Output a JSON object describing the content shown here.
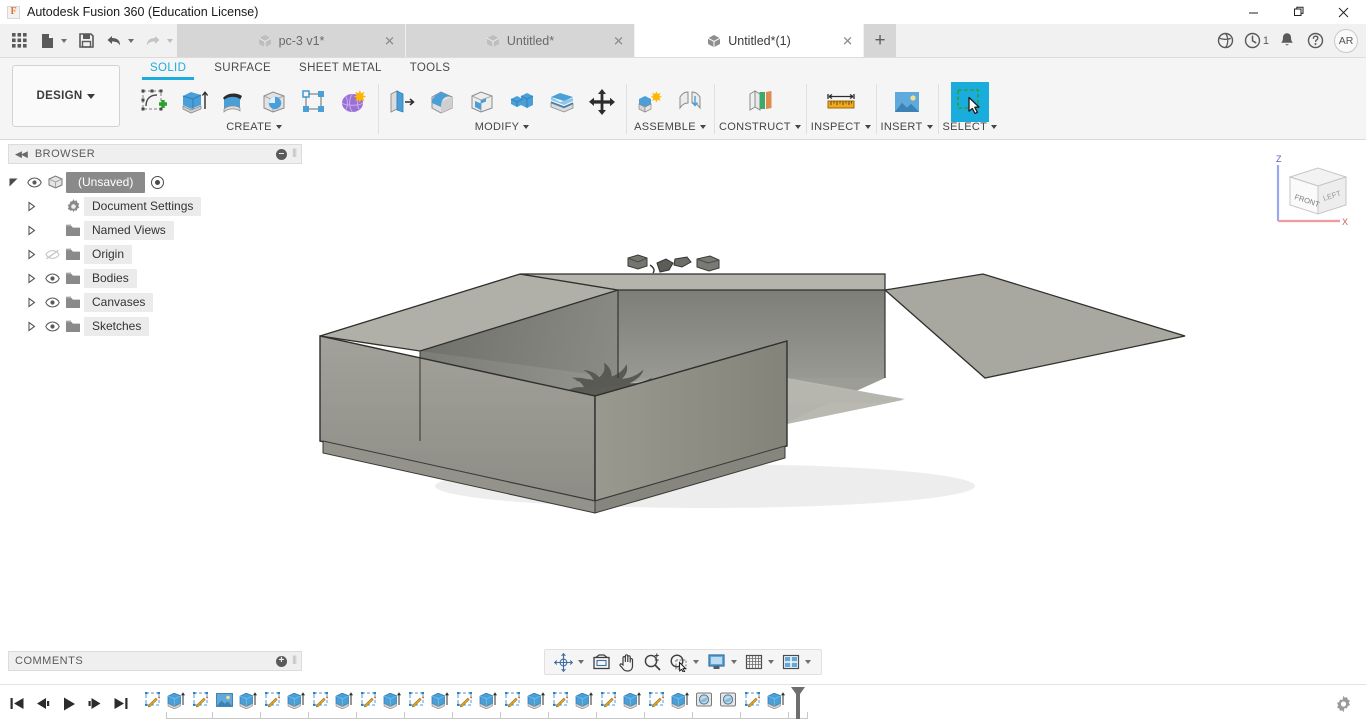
{
  "window": {
    "title": "Autodesk Fusion 360 (Education License)",
    "logo_letter": "F",
    "minimize": "—",
    "maximize": "❐",
    "close": "✕"
  },
  "quick_access": {
    "items": [
      {
        "name": "app-grid-icon",
        "label": ""
      },
      {
        "name": "new-file-icon",
        "label": ""
      },
      {
        "name": "save-icon",
        "label": ""
      },
      {
        "name": "undo-icon",
        "label": ""
      },
      {
        "name": "redo-icon",
        "label": ""
      }
    ]
  },
  "document_tabs": [
    {
      "label": "pc-3 v1*",
      "active": false,
      "close": "✕"
    },
    {
      "label": "Untitled*",
      "active": false,
      "close": "✕"
    },
    {
      "label": "Untitled*(1)",
      "active": true,
      "close": "✕"
    }
  ],
  "tab_add_label": "+",
  "tabstrip_right": [
    {
      "name": "extensions-icon",
      "badge": ""
    },
    {
      "name": "job-status-icon",
      "badge": "1"
    },
    {
      "name": "notifications-bell-icon",
      "badge": ""
    },
    {
      "name": "help-icon",
      "badge": ""
    }
  ],
  "avatar_initials": "AR",
  "ribbon": {
    "workspace_label": "DESIGN",
    "tabs": [
      {
        "label": "SOLID",
        "active": true
      },
      {
        "label": "SURFACE",
        "active": false
      },
      {
        "label": "SHEET METAL",
        "active": false
      },
      {
        "label": "TOOLS",
        "active": false
      }
    ],
    "panels": [
      {
        "label": "CREATE",
        "has_caret": true,
        "tools": [
          {
            "name": "create-sketch-icon",
            "selected": false
          },
          {
            "name": "extrude-icon",
            "selected": false
          },
          {
            "name": "revolve-icon",
            "selected": false
          },
          {
            "name": "sweep-icon",
            "selected": false
          },
          {
            "name": "pattern-icon",
            "selected": false
          },
          {
            "name": "form-icon",
            "selected": false
          }
        ]
      },
      {
        "label": "MODIFY",
        "has_caret": true,
        "tools": [
          {
            "name": "press-pull-icon",
            "selected": false
          },
          {
            "name": "fillet-icon",
            "selected": false
          },
          {
            "name": "shell-icon",
            "selected": false
          },
          {
            "name": "combine-icon",
            "selected": false
          },
          {
            "name": "split-face-icon",
            "selected": false
          },
          {
            "name": "move-copy-icon",
            "selected": false
          }
        ]
      },
      {
        "label": "ASSEMBLE",
        "has_caret": true,
        "tools": [
          {
            "name": "new-component-icon",
            "selected": false
          },
          {
            "name": "joint-icon",
            "selected": false
          }
        ]
      },
      {
        "label": "CONSTRUCT",
        "has_caret": true,
        "tools": [
          {
            "name": "construct-plane-icon",
            "selected": false
          }
        ]
      },
      {
        "label": "INSPECT",
        "has_caret": true,
        "tools": [
          {
            "name": "measure-icon",
            "selected": false
          }
        ]
      },
      {
        "label": "INSERT",
        "has_caret": true,
        "tools": [
          {
            "name": "insert-canvas-icon",
            "selected": false
          }
        ]
      },
      {
        "label": "SELECT",
        "has_caret": true,
        "tools": [
          {
            "name": "select-window-icon",
            "selected": true
          }
        ]
      }
    ]
  },
  "browser": {
    "title": "BROWSER",
    "collapse_icon": "◀◀",
    "minus_label": "–",
    "nodes": [
      {
        "label": "(Unsaved)",
        "icon": "component-cube-icon",
        "root": true,
        "eye": true,
        "twisty": "expanded",
        "radio": true
      },
      {
        "label": "Document Settings",
        "icon": "gear-icon",
        "root": false,
        "eye": false,
        "twisty": "collapsed",
        "radio": false
      },
      {
        "label": "Named Views",
        "icon": "folder-icon",
        "root": false,
        "eye": false,
        "twisty": "collapsed",
        "radio": false
      },
      {
        "label": "Origin",
        "icon": "folder-icon",
        "root": false,
        "eye": true,
        "eye_off": true,
        "twisty": "collapsed",
        "radio": false
      },
      {
        "label": "Bodies",
        "icon": "folder-icon",
        "root": false,
        "eye": true,
        "twisty": "collapsed",
        "radio": false
      },
      {
        "label": "Canvases",
        "icon": "folder-icon",
        "root": false,
        "eye": true,
        "twisty": "collapsed",
        "radio": false
      },
      {
        "label": "Sketches",
        "icon": "folder-icon",
        "root": false,
        "eye": true,
        "twisty": "collapsed",
        "radio": false
      }
    ]
  },
  "comments": {
    "title": "COMMENTS",
    "plus_label": "+"
  },
  "viewcube": {
    "front_label": "FRONT",
    "left_label": "LEFT",
    "axis_x": "X",
    "axis_z": "Z"
  },
  "navbar": {
    "items": [
      {
        "name": "orbit-icon",
        "caret": true
      },
      {
        "name": "look-at-icon",
        "caret": false
      },
      {
        "name": "pan-icon",
        "caret": false
      },
      {
        "name": "zoom-icon",
        "caret": false
      },
      {
        "name": "zoom-window-icon",
        "caret": true
      },
      {
        "name": "display-settings-icon",
        "caret": true
      },
      {
        "name": "grid-snap-icon",
        "caret": true
      },
      {
        "name": "viewports-icon",
        "caret": true
      }
    ]
  },
  "timeline": {
    "playback": [
      {
        "name": "go-to-beginning-icon"
      },
      {
        "name": "step-back-icon"
      },
      {
        "name": "play-icon"
      },
      {
        "name": "step-forward-icon"
      },
      {
        "name": "go-to-end-icon"
      }
    ],
    "features": [
      {
        "type": "sketch"
      },
      {
        "type": "extrude"
      },
      {
        "type": "sketch"
      },
      {
        "type": "canvas"
      },
      {
        "type": "extrude"
      },
      {
        "type": "sketch"
      },
      {
        "type": "extrude"
      },
      {
        "type": "sketch"
      },
      {
        "type": "extrude"
      },
      {
        "type": "sketch"
      },
      {
        "type": "extrude"
      },
      {
        "type": "sketch"
      },
      {
        "type": "extrude"
      },
      {
        "type": "sketch"
      },
      {
        "type": "extrude"
      },
      {
        "type": "sketch"
      },
      {
        "type": "extrude"
      },
      {
        "type": "sketch"
      },
      {
        "type": "extrude"
      },
      {
        "type": "sketch"
      },
      {
        "type": "extrude"
      },
      {
        "type": "sketch"
      },
      {
        "type": "extrude"
      },
      {
        "type": "hole"
      },
      {
        "type": "hole"
      },
      {
        "type": "sketch"
      },
      {
        "type": "extrude"
      }
    ],
    "settings_icon": "gear-icon"
  },
  "colors": {
    "accent": "#1aacdd",
    "tool_blue": "#4a9fd8",
    "select_tile": "#1aacdd",
    "tab_inactive": "#d6d6d6",
    "ribbon_bg": "#f5f5f5",
    "model_gray": "#8e8e88"
  }
}
